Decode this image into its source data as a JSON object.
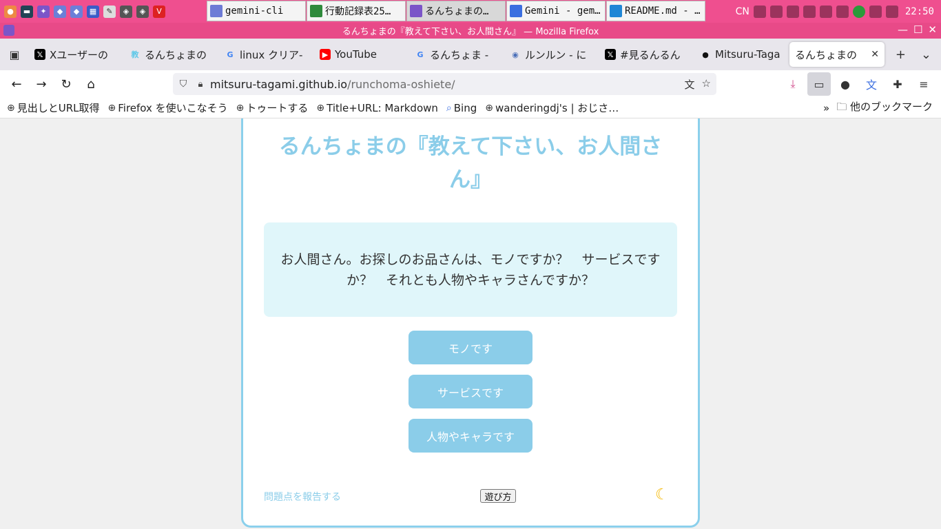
{
  "taskbar": {
    "tasks": [
      {
        "label": "gemini-cli",
        "color": "#6d7bd6"
      },
      {
        "label": "行動記録表25…",
        "color": "#2f8a3c"
      },
      {
        "label": "るんちょまの…",
        "color": "#7b55c8"
      },
      {
        "label": "Gemini - gem…",
        "color": "#3b6ee0"
      },
      {
        "label": "README.md - …",
        "color": "#1f86d6"
      }
    ],
    "tray_text": "CN",
    "clock": "22:50"
  },
  "window": {
    "title": "るんちょまの『教えて下さい、お人間さん』 — Mozilla Firefox"
  },
  "tabs": [
    {
      "label": "Xユーザーの",
      "icon": "x-icon",
      "fav": "𝕏",
      "fav_bg": "#000000",
      "fav_fg": "#ffffff"
    },
    {
      "label": "るんちょまの",
      "icon": "kyo-icon",
      "fav": "教",
      "fav_bg": "transparent",
      "fav_fg": "#5ec8e8"
    },
    {
      "label": "linux クリア-",
      "icon": "google-icon",
      "fav": "G",
      "fav_bg": "transparent",
      "fav_fg": "#4285f4"
    },
    {
      "label": "YouTube",
      "icon": "youtube-icon",
      "fav": "▶",
      "fav_bg": "#ff0000",
      "fav_fg": "#ffffff"
    },
    {
      "label": "るんちょま -",
      "icon": "google-icon",
      "fav": "G",
      "fav_bg": "transparent",
      "fav_fg": "#4285f4"
    },
    {
      "label": "ルンルン - に",
      "icon": "globe-icon",
      "fav": "◉",
      "fav_bg": "transparent",
      "fav_fg": "#4b6fb8"
    },
    {
      "label": "#見るんるん",
      "icon": "x-icon",
      "fav": "𝕏",
      "fav_bg": "#000000",
      "fav_fg": "#ffffff"
    },
    {
      "label": "Mitsuru-Taga",
      "icon": "github-icon",
      "fav": "●",
      "fav_bg": "transparent",
      "fav_fg": "#111111"
    },
    {
      "label": "るんちょまの",
      "icon": "none",
      "fav": "",
      "fav_bg": "transparent",
      "fav_fg": "#111111",
      "active": true
    }
  ],
  "url": {
    "host": "mitsuru-tagami.github.io",
    "path": "/runchoma-oshiete/"
  },
  "bookmarks": [
    {
      "label": "見出しとURL取得"
    },
    {
      "label": "Firefox を使いこなそう"
    },
    {
      "label": "トゥートする"
    },
    {
      "label": "Title+URL: Markdown"
    },
    {
      "label": "Bing"
    },
    {
      "label": "wanderingdj's | おじさ…"
    }
  ],
  "other_bookmarks": "他のブックマーク",
  "page": {
    "title": "るんちょまの『教えて下さい、お人間さん』",
    "question": "お人間さん。お探しのお品さんは、モノですか？　サービスですか？　それとも人物やキャラさんですか？",
    "answers": [
      "モノです",
      "サービスです",
      "人物やキャラです"
    ],
    "report_link": "問題点を報告する",
    "howto_button": "遊び方"
  },
  "colors": {
    "accent": "#8bcde9",
    "question_bg": "#e0f6fa",
    "taskbar": "#ef4f8f"
  }
}
